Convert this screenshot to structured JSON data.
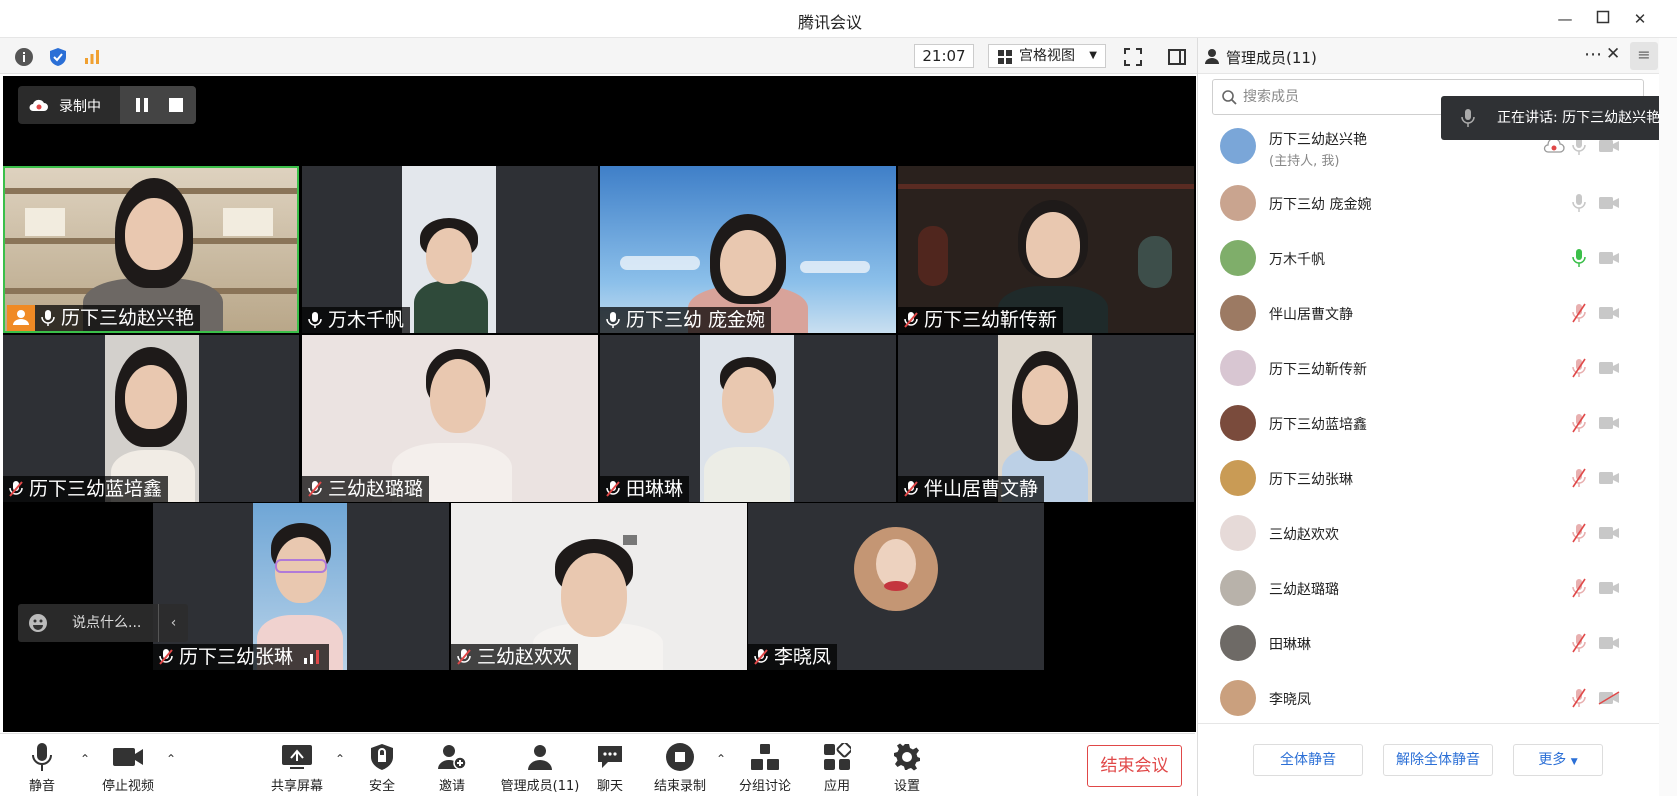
{
  "window": {
    "title": "腾讯会议"
  },
  "toolbar": {
    "time": "21:07",
    "view_label": "宫格视图"
  },
  "recording": {
    "label": "录制中"
  },
  "tiles": [
    {
      "name": "历下三幼赵兴艳",
      "bg": "#c9b8a0",
      "mic": "on"
    },
    {
      "name": "万木千帆",
      "bg": "#dfe3e8",
      "mic": "on"
    },
    {
      "name": "历下三幼 庞金婉",
      "bg": "#4b86c9",
      "mic": "on"
    },
    {
      "name": "历下三幼靳传新",
      "bg": "#3a2e2a",
      "mic": "muted"
    },
    {
      "name": "历下三幼蓝培鑫",
      "bg": "#cfcac5",
      "mic": "muted"
    },
    {
      "name": "三幼赵璐璐",
      "bg": "#e8e1df",
      "mic": "muted"
    },
    {
      "name": "田琳琳",
      "bg": "#d7dde8",
      "mic": "muted"
    },
    {
      "name": "伴山居曹文静",
      "bg": "#d9d4cd",
      "mic": "muted"
    },
    {
      "name": "历下三幼张琳",
      "bg": "#8fb3d1",
      "mic": "muted"
    },
    {
      "name": "三幼赵欢欢",
      "bg": "#ecebea",
      "mic": "muted"
    },
    {
      "name": "李晓凤",
      "bg": "#2e3035",
      "mic": "muted"
    }
  ],
  "chat": {
    "placeholder": "说点什么..."
  },
  "bottom": {
    "mute": "静音",
    "stop_video": "停止视频",
    "share": "共享屏幕",
    "security": "安全",
    "invite": "邀请",
    "members": "管理成员(11)",
    "chat": "聊天",
    "end_record": "结束录制",
    "breakout": "分组讨论",
    "apps": "应用",
    "settings": "设置",
    "end_meeting": "结束会议"
  },
  "sidebar": {
    "title": "管理成员(11)",
    "search_placeholder": "搜索成员",
    "speaking_tooltip": "正在讲话: 历下三幼赵兴艳;",
    "members": [
      {
        "name": "历下三幼赵兴艳",
        "sub": "(主持人, 我)",
        "mic": "on",
        "av": "#7aa6d8"
      },
      {
        "name": "历下三幼 庞金婉",
        "sub": "",
        "mic": "on",
        "av": "#c9a48f"
      },
      {
        "name": "万木千帆",
        "sub": "",
        "mic": "active",
        "av": "#7fae6a"
      },
      {
        "name": "伴山居曹文静",
        "sub": "",
        "mic": "muted",
        "av": "#9c7a63"
      },
      {
        "name": "历下三幼靳传新",
        "sub": "",
        "mic": "muted",
        "av": "#d8c6d2"
      },
      {
        "name": "历下三幼蓝培鑫",
        "sub": "",
        "mic": "muted",
        "av": "#7a4b3c"
      },
      {
        "name": "历下三幼张琳",
        "sub": "",
        "mic": "muted",
        "av": "#c99b55"
      },
      {
        "name": "三幼赵欢欢",
        "sub": "",
        "mic": "muted",
        "av": "#e6dad8"
      },
      {
        "name": "三幼赵璐璐",
        "sub": "",
        "mic": "muted",
        "av": "#b8b2aa"
      },
      {
        "name": "田琳琳",
        "sub": "",
        "mic": "muted",
        "av": "#6e6a66"
      },
      {
        "name": "李晓凤",
        "sub": "",
        "mic": "muted",
        "av": "#caa07e"
      }
    ],
    "mute_all": "全体静音",
    "unmute_all": "解除全体静音",
    "more": "更多"
  },
  "colors": {
    "accent": "#2b6fd6",
    "danger": "#e04848",
    "active_mic": "#3bbf4a"
  }
}
